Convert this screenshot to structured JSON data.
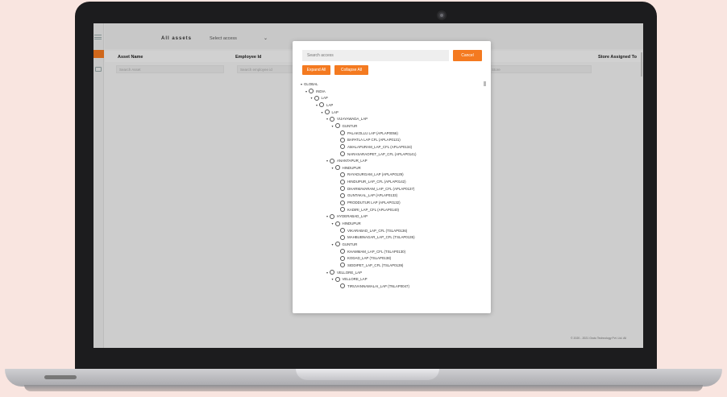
{
  "header": {
    "title": "All assets",
    "select_access": "Select access",
    "select_chevron": "⌄"
  },
  "table": {
    "columns": [
      "Asset Name",
      "Employee Id",
      "Store Assigned To"
    ],
    "filters": [
      "Search Asset",
      "Search employee id",
      "ch Store"
    ]
  },
  "footer": "© 2020 - 2021 Groto Technology Pvt. Ltd. All",
  "modal": {
    "search_placeholder": "Search access",
    "cancel_label": "Cancel",
    "expand_all_label": "Expand All",
    "collapse_all_label": "Collapse All",
    "tree": [
      {
        "label": "GLOBAL",
        "level": 0,
        "caret": true,
        "radio": false
      },
      {
        "label": "INDIA",
        "level": 1,
        "caret": true,
        "radio": true
      },
      {
        "label": "LAP",
        "level": 2,
        "caret": true,
        "radio": true
      },
      {
        "label": "LAP",
        "level": 3,
        "caret": true,
        "radio": true
      },
      {
        "label": "LAP",
        "level": 4,
        "caret": true,
        "radio": true
      },
      {
        "label": "VIJAYAWADA_LAP",
        "level": 5,
        "caret": true,
        "radio": true
      },
      {
        "label": "GUNTUR",
        "level": 6,
        "caret": true,
        "radio": true
      },
      {
        "label": "PALAKOLLU LAP (APLAP0056)",
        "level": 7,
        "caret": false,
        "radio": true
      },
      {
        "label": "BAPATLA LAP CFL (APLAP0131)",
        "level": 7,
        "caret": false,
        "radio": true
      },
      {
        "label": "AMALAPURAM_LAP_CFL (APLAP0134)",
        "level": 7,
        "caret": false,
        "radio": true
      },
      {
        "label": "NARASARAOPET_LAP_CFL (APLAP0141)",
        "level": 7,
        "caret": false,
        "radio": true
      },
      {
        "label": "ANANTAPUR_LAP",
        "level": 5,
        "caret": true,
        "radio": true
      },
      {
        "label": "HINDUPUR",
        "level": 6,
        "caret": true,
        "radio": true
      },
      {
        "label": "RAYADURGAM_LAP (APLAP0129)",
        "level": 7,
        "caret": false,
        "radio": true
      },
      {
        "label": "HINDUPUR_LAP_CFL (APLAP0142)",
        "level": 7,
        "caret": false,
        "radio": true
      },
      {
        "label": "DHARMAVARAM_LAP_CFL (APLAP0137)",
        "level": 7,
        "caret": false,
        "radio": true
      },
      {
        "label": "GUNTAKAL_LAP (APLAP0133)",
        "level": 7,
        "caret": false,
        "radio": true
      },
      {
        "label": "PRODDUTUR LAP (APLAP0132)",
        "level": 7,
        "caret": false,
        "radio": true
      },
      {
        "label": "KADIRI_LAP_CFL (APLAP0140)",
        "level": 7,
        "caret": false,
        "radio": true
      },
      {
        "label": "HYDERABAD_LAP",
        "level": 5,
        "caret": true,
        "radio": true
      },
      {
        "label": "HINDUPUR",
        "level": 6,
        "caret": true,
        "radio": true
      },
      {
        "label": "VIKARABAD_LAP_CFL (TSLAP0136)",
        "level": 7,
        "caret": false,
        "radio": true
      },
      {
        "label": "MAHBUBNAGAR_LAP_CFL (TSLAP0135)",
        "level": 7,
        "caret": false,
        "radio": true
      },
      {
        "label": "GUNTUR",
        "level": 6,
        "caret": true,
        "radio": true
      },
      {
        "label": "KHAMMAM_LAP_CFL (TSLAP0130)",
        "level": 7,
        "caret": false,
        "radio": true
      },
      {
        "label": "KODAD_LAP (TSLAP0138)",
        "level": 7,
        "caret": false,
        "radio": true
      },
      {
        "label": "SIDDIPET_LAP_CFL (TSLAP0139)",
        "level": 7,
        "caret": false,
        "radio": true
      },
      {
        "label": "VELLORE_LAP",
        "level": 5,
        "caret": true,
        "radio": true
      },
      {
        "label": "VELLORE_LAP",
        "level": 6,
        "caret": true,
        "radio": true
      },
      {
        "label": "TIRUVANNAMALAI_LAP (TNLAP0047)",
        "level": 7,
        "caret": false,
        "radio": true
      }
    ]
  },
  "colors": {
    "accent": "#f47a20",
    "background": "#f9e5e0",
    "laptop_bezel": "#1c1c1e"
  },
  "icons": {
    "tree_caret": "▾"
  }
}
